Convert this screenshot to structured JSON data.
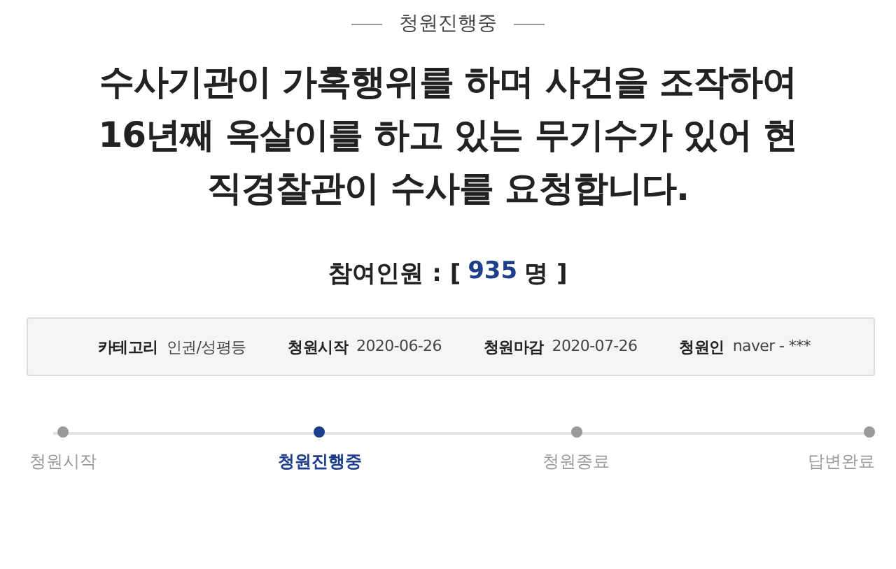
{
  "status_label": "청원진행중",
  "title_lines": [
    "수사기관이 가혹행위를 하며 사건을 조작하여",
    "16년째 옥살이를 하고 있는 무기수가 있어 현",
    "직경찰관이 수사를 요청합니다."
  ],
  "participants": {
    "label": "참여인원 : [",
    "count": "935",
    "suffix": "명 ]"
  },
  "info": [
    {
      "label": "카테고리",
      "value": "인권/성평등"
    },
    {
      "label": "청원시작",
      "value": "2020-06-26"
    },
    {
      "label": "청원마감",
      "value": "2020-07-26"
    },
    {
      "label": "청원인",
      "value": "naver - ***"
    }
  ],
  "steps": [
    {
      "label": "청원시작",
      "selected": false
    },
    {
      "label": "청원진행중",
      "selected": true
    },
    {
      "label": "청원종료",
      "selected": false
    },
    {
      "label": "답변완료",
      "selected": false
    }
  ]
}
